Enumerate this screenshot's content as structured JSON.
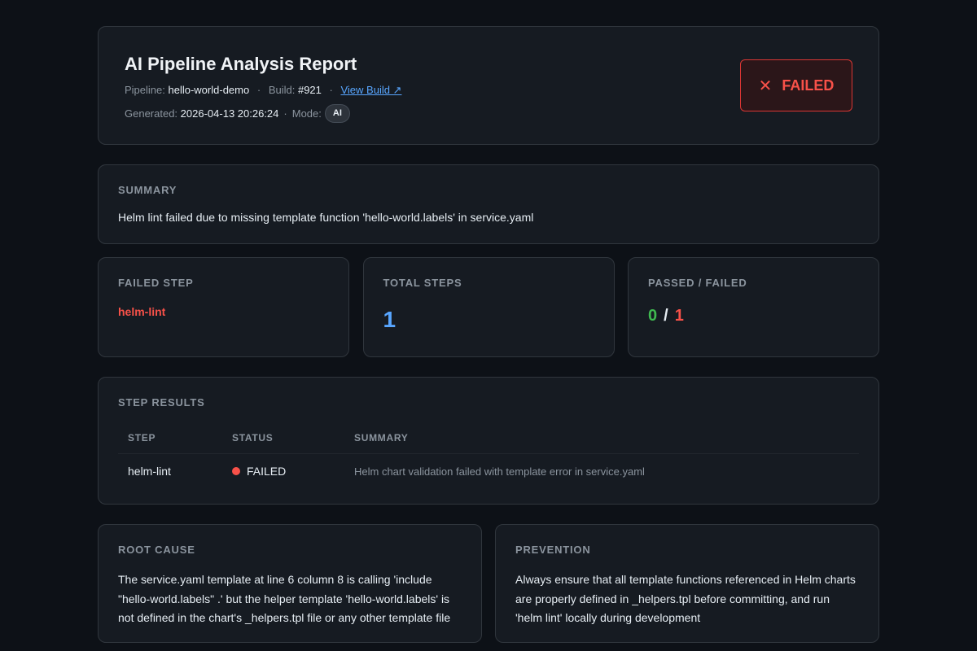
{
  "header": {
    "title": "AI Pipeline Analysis Report",
    "pipeline_label": "Pipeline:",
    "pipeline_value": "hello-world-demo",
    "build_label": "Build:",
    "build_value": "#921",
    "view_build_label": "View Build ↗",
    "generated_label": "Generated:",
    "generated_value": "2026-04-13 20:26:24",
    "mode_label": "Mode:",
    "mode_value": "AI",
    "separator": "·",
    "status_icon": "✕",
    "status_label": "FAILED"
  },
  "summary": {
    "label": "SUMMARY",
    "text": "Helm lint failed due to missing template function 'hello-world.labels' in service.yaml"
  },
  "stats": {
    "failed_step_label": "FAILED STEP",
    "failed_step_value": "helm-lint",
    "total_steps_label": "TOTAL STEPS",
    "total_steps_value": "1",
    "passed_failed_label": "PASSED / FAILED",
    "passed_value": "0",
    "divider": "/",
    "failed_value": "1"
  },
  "step_results": {
    "label": "STEP RESULTS",
    "columns": [
      "STEP",
      "STATUS",
      "SUMMARY"
    ],
    "rows": [
      {
        "step": "helm-lint",
        "status": "FAILED",
        "summary": "Helm chart validation failed with template error in service.yaml"
      }
    ]
  },
  "root_cause": {
    "label": "ROOT CAUSE",
    "text": "The service.yaml template at line 6 column 8 is calling 'include \"hello-world.labels\" .' but the helper template 'hello-world.labels' is not defined in the chart's _helpers.tpl file or any other template file"
  },
  "prevention": {
    "label": "PREVENTION",
    "text": "Always ensure that all template functions referenced in Helm charts are properly defined in _helpers.tpl before committing, and run 'helm lint' locally during development"
  },
  "colors": {
    "background": "#0d1117",
    "card": "#161b22",
    "border": "#30363d",
    "failed": "#f85149",
    "passed": "#3fb950",
    "accent": "#58a6ff"
  },
  "icons": {
    "status": "close-icon",
    "external_link": "external-link-icon",
    "status_dot": "status-dot-icon"
  }
}
